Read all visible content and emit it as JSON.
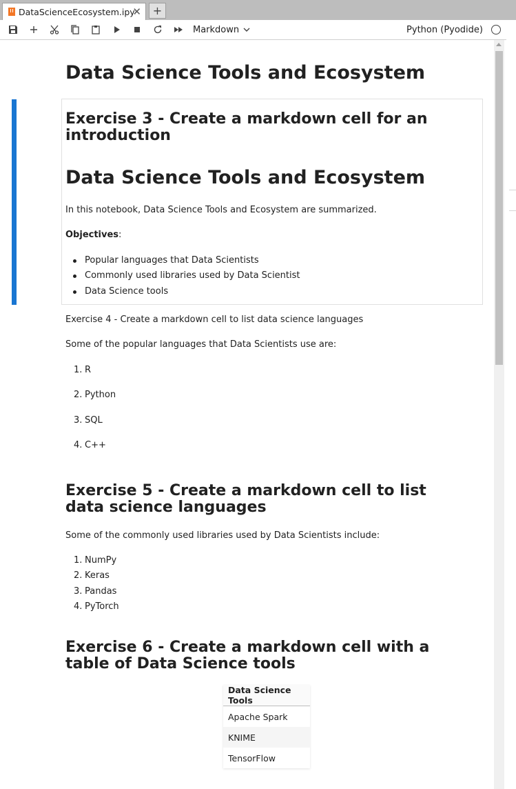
{
  "tab": {
    "title": "DataScienceEcosystem.ipynb",
    "close": "✕",
    "new": "+"
  },
  "toolbar": {
    "cell_type": "Markdown",
    "kernel": "Python (Pyodide)"
  },
  "notebook": {
    "title": "Data Science Tools and Ecosystem",
    "ex3": {
      "heading": "Exercise 3 - Create a markdown cell for an introduction",
      "h1": "Data Science Tools and Ecosystem",
      "intro": "In this notebook, Data Science Tools and Ecosystem are summarized.",
      "objectives_label": "Objectives",
      "objectives_colon": ":",
      "objectives": [
        "Popular languages that Data Scientists",
        "Commonly used libraries used by Data Scientist",
        "Data Science tools"
      ]
    },
    "ex4": {
      "heading": "Exercise 4 - Create a markdown cell to list data science languages",
      "intro": "Some of the popular languages that Data Scientists use are:",
      "languages": [
        "R",
        "Python",
        "SQL",
        "C++"
      ]
    },
    "ex5": {
      "heading": "Exercise 5 - Create a markdown cell to list data science languages",
      "intro": "Some of the commonly used libraries used by Data Scientists include:",
      "libraries": [
        "NumPy",
        "Keras",
        "Pandas",
        "PyTorch"
      ]
    },
    "ex6": {
      "heading": "Exercise 6 - Create a markdown cell with a table of Data Science tools",
      "table_header": "Data Science Tools",
      "tools": [
        "Apache Spark",
        "KNIME",
        "TensorFlow"
      ]
    }
  }
}
